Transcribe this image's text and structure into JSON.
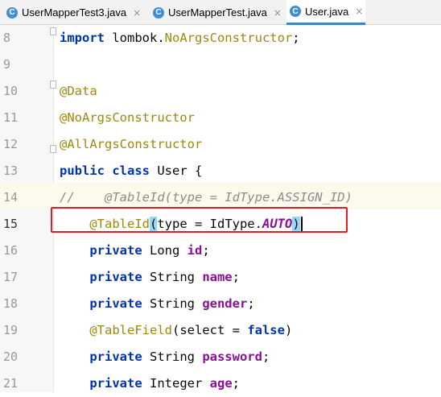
{
  "tabs": [
    {
      "icon": "C",
      "label": "UserMapperTest3.java",
      "close": "×"
    },
    {
      "icon": "C",
      "label": "UserMapperTest.java",
      "close": "×"
    },
    {
      "icon": "C",
      "label": "User.java",
      "close": "×",
      "active": true
    }
  ],
  "editor": {
    "lines": [
      {
        "num": "8",
        "parts": [
          {
            "cls": "kw",
            "text": "import"
          },
          {
            "cls": "",
            "text": " lombok."
          },
          {
            "cls": "ann",
            "text": "NoArgsConstructor"
          },
          {
            "cls": "",
            "text": ";"
          }
        ]
      },
      {
        "num": "9",
        "parts": []
      },
      {
        "num": "10",
        "parts": [
          {
            "cls": "ann",
            "text": "@Data"
          }
        ]
      },
      {
        "num": "11",
        "parts": [
          {
            "cls": "ann",
            "text": "@NoArgsConstructor"
          }
        ]
      },
      {
        "num": "12",
        "parts": [
          {
            "cls": "ann",
            "text": "@AllArgsConstructor"
          }
        ]
      },
      {
        "num": "13",
        "parts": [
          {
            "cls": "kw",
            "text": "public"
          },
          {
            "cls": "",
            "text": " "
          },
          {
            "cls": "kw",
            "text": "class"
          },
          {
            "cls": "",
            "text": " User {"
          }
        ]
      },
      {
        "num": "14",
        "parts": [
          {
            "cls": "cmt",
            "text": "//    @TableId(type = IdType.ASSIGN_ID)"
          }
        ]
      },
      {
        "num": "15",
        "parts": [
          {
            "cls": "",
            "text": "    "
          },
          {
            "cls": "ann",
            "text": "@TableId"
          },
          {
            "cls": "paren",
            "text": "("
          },
          {
            "cls": "",
            "text": "type = IdType."
          },
          {
            "cls": "ital",
            "text": "AUTO"
          },
          {
            "cls": "paren",
            "text": ")"
          }
        ]
      },
      {
        "num": "16",
        "parts": [
          {
            "cls": "",
            "text": "    "
          },
          {
            "cls": "kw",
            "text": "private"
          },
          {
            "cls": "",
            "text": " Long "
          },
          {
            "cls": "field",
            "text": "id"
          },
          {
            "cls": "",
            "text": ";"
          }
        ]
      },
      {
        "num": "17",
        "parts": [
          {
            "cls": "",
            "text": "    "
          },
          {
            "cls": "kw",
            "text": "private"
          },
          {
            "cls": "",
            "text": " String "
          },
          {
            "cls": "field",
            "text": "name"
          },
          {
            "cls": "",
            "text": ";"
          }
        ]
      },
      {
        "num": "18",
        "parts": [
          {
            "cls": "",
            "text": "    "
          },
          {
            "cls": "kw",
            "text": "private"
          },
          {
            "cls": "",
            "text": " String "
          },
          {
            "cls": "field",
            "text": "gender"
          },
          {
            "cls": "",
            "text": ";"
          }
        ]
      },
      {
        "num": "19",
        "parts": [
          {
            "cls": "",
            "text": "    "
          },
          {
            "cls": "ann",
            "text": "@TableField"
          },
          {
            "cls": "",
            "text": "(select = "
          },
          {
            "cls": "kw",
            "text": "false"
          },
          {
            "cls": "",
            "text": ")"
          }
        ]
      },
      {
        "num": "20",
        "parts": [
          {
            "cls": "",
            "text": "    "
          },
          {
            "cls": "kw",
            "text": "private"
          },
          {
            "cls": "",
            "text": " String "
          },
          {
            "cls": "field",
            "text": "password"
          },
          {
            "cls": "",
            "text": ";"
          }
        ]
      },
      {
        "num": "21",
        "parts": [
          {
            "cls": "",
            "text": "    "
          },
          {
            "cls": "kw",
            "text": "private"
          },
          {
            "cls": "",
            "text": " Integer "
          },
          {
            "cls": "field",
            "text": "age"
          },
          {
            "cls": "",
            "text": ";"
          }
        ]
      }
    ]
  },
  "colors": {
    "keyword": "#0033b3",
    "annotation": "#9e880d",
    "field": "#871094",
    "comment": "#8c8c8c",
    "highlight_box": "#e02020",
    "tab_accent": "#4083c9"
  }
}
